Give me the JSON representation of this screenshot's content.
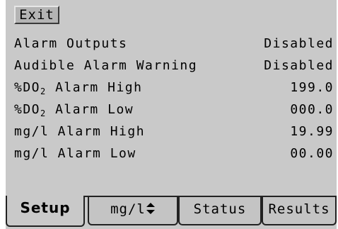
{
  "exit_label": "Exit",
  "settings": [
    {
      "label": "Alarm Outputs",
      "value": "Disabled"
    },
    {
      "label": "Audible Alarm Warning",
      "value": "Disabled"
    },
    {
      "label_pre": "%DO",
      "label_sub": "2",
      "label_post": " Alarm High",
      "value": "199.0"
    },
    {
      "label_pre": "%DO",
      "label_sub": "2",
      "label_post": " Alarm Low",
      "value": "000.0"
    },
    {
      "label": "mg/l Alarm High",
      "value": "19.99"
    },
    {
      "label": "mg/l Alarm Low",
      "value": "00.00"
    }
  ],
  "tabs": {
    "setup": "Setup",
    "mgl": "mg/l",
    "status": "Status",
    "results": "Results"
  },
  "icons": {
    "mgl_toggle": "up-down-arrows-icon"
  },
  "colors": {
    "background": "#c9c9c9",
    "border": "#222222"
  }
}
